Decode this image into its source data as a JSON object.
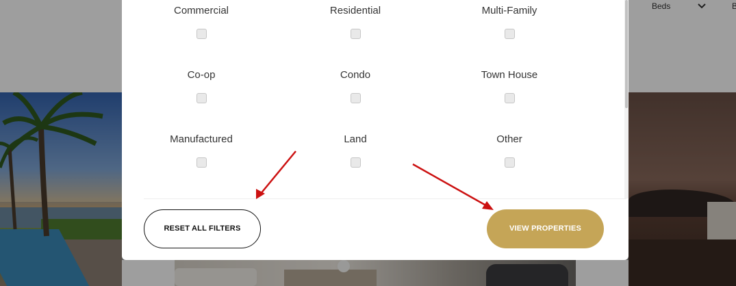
{
  "header": {
    "filters": [
      {
        "label": "Beds"
      },
      {
        "label": "B"
      }
    ]
  },
  "modal": {
    "property_types": [
      {
        "label": "Commercial",
        "checked": false
      },
      {
        "label": "Residential",
        "checked": false
      },
      {
        "label": "Multi-Family",
        "checked": false
      },
      {
        "label": "Co-op",
        "checked": false
      },
      {
        "label": "Condo",
        "checked": false
      },
      {
        "label": "Town House",
        "checked": false
      },
      {
        "label": "Manufactured",
        "checked": false
      },
      {
        "label": "Land",
        "checked": false
      },
      {
        "label": "Other",
        "checked": false
      }
    ],
    "reset_label": "RESET ALL FILTERS",
    "view_label": "VIEW PROPERTIES"
  },
  "colors": {
    "accent_gold": "#c5a557",
    "annotation_arrow": "#cc1111"
  }
}
